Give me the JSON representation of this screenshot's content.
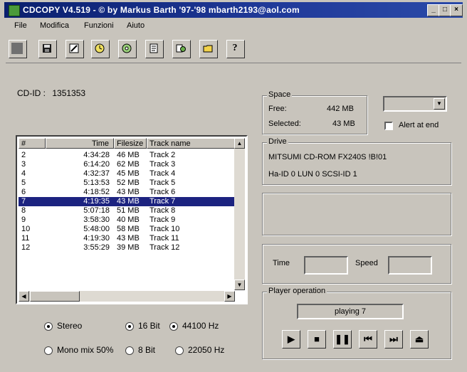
{
  "window": {
    "title": "CDCOPY  V4.519  - © by Markus Barth '97-'98 mbarth2193@aol.com"
  },
  "title_buttons": [
    "_",
    "□",
    "×"
  ],
  "menu": [
    "File",
    "Modifica",
    "Funzioni",
    "Aiuto"
  ],
  "toolbar_icons": [
    "stop-icon",
    "save-icon",
    "edit-icon",
    "clock-icon",
    "disc-icon",
    "document-icon",
    "copy-icon",
    "folder-icon",
    "help-icon"
  ],
  "cd_id": {
    "label": "CD-ID :",
    "value": "1351353"
  },
  "track_list": {
    "columns": [
      "#",
      "Time",
      "Filesize",
      "Track name"
    ],
    "rows": [
      [
        "2",
        "4:34:28",
        "46 MB",
        "Track  2"
      ],
      [
        "3",
        "6:14:20",
        "62 MB",
        "Track  3"
      ],
      [
        "4",
        "4:32:37",
        "45 MB",
        "Track  4"
      ],
      [
        "5",
        "5:13:53",
        "52 MB",
        "Track  5"
      ],
      [
        "6",
        "4:18:52",
        "43 MB",
        "Track  6"
      ],
      [
        "7",
        "4:19:35",
        "43 MB",
        "Track  7"
      ],
      [
        "8",
        "5:07:18",
        "51 MB",
        "Track  8"
      ],
      [
        "9",
        "3:58:30",
        "40 MB",
        "Track  9"
      ],
      [
        "10",
        "5:48:00",
        "58 MB",
        "Track 10"
      ],
      [
        "11",
        "4:19:30",
        "43 MB",
        "Track 11"
      ],
      [
        "12",
        "3:55:29",
        "39 MB",
        "Track 12"
      ]
    ],
    "selected_index": 5
  },
  "audio_options": {
    "stereo": "Stereo",
    "mono": "Mono mix 50%",
    "bit16": "16 Bit",
    "bit8": "8 Bit",
    "hz44": "44100 Hz",
    "hz22": "22050 Hz"
  },
  "space": {
    "label": "Space",
    "free_label": "Free:",
    "free_value": "442 MB",
    "selected_label": "Selected:",
    "selected_value": "43 MB"
  },
  "alert": {
    "label": "Alert at end",
    "checked": false
  },
  "drive": {
    "label": "Drive",
    "name": "MITSUMI CD-ROM FX240S !B!01",
    "ids": "Ha-ID 0 LUN 0 SCSI-ID 1"
  },
  "time_speed": {
    "time_label": "Time",
    "speed_label": "Speed"
  },
  "player": {
    "label": "Player operation",
    "status": "playing 7",
    "buttons": [
      "play-icon",
      "stop-icon",
      "pause-icon",
      "previous-icon",
      "next-icon",
      "eject-icon"
    ]
  },
  "colors": {
    "title_bar": "#0a1f6e",
    "selection": "#1c2380",
    "window_bg": "#c8c4bc"
  }
}
